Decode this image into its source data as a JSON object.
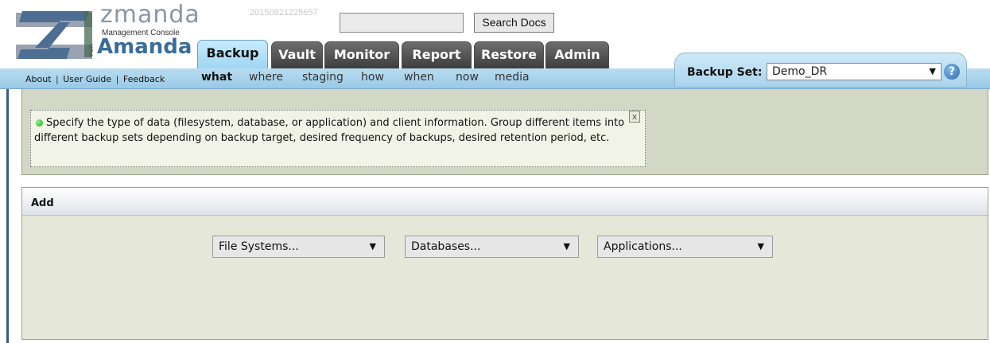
{
  "header": {
    "logo": {
      "brand": "zmanda",
      "subtitle": "Management Console",
      "for_label": "FOR",
      "product": "Amanda"
    },
    "build_id": "20150821225657",
    "search": {
      "value": "",
      "button_label": "Search Docs"
    }
  },
  "tabs": [
    {
      "label": "Backup",
      "active": true
    },
    {
      "label": "Vault",
      "active": false
    },
    {
      "label": "Monitor",
      "active": false
    },
    {
      "label": "Report",
      "active": false
    },
    {
      "label": "Restore",
      "active": false
    },
    {
      "label": "Admin",
      "active": false
    }
  ],
  "nav_links": {
    "about": "About",
    "user_guide": "User Guide",
    "feedback": "Feedback",
    "separator": "|"
  },
  "subtabs": [
    {
      "label": "what",
      "active": true
    },
    {
      "label": "where",
      "active": false
    },
    {
      "label": "staging",
      "active": false
    },
    {
      "label": "how",
      "active": false
    },
    {
      "label": "when",
      "active": false
    },
    {
      "label": "now",
      "active": false
    },
    {
      "label": "media",
      "active": false
    }
  ],
  "backup_set": {
    "label": "Backup Set:",
    "selected": "Demo_DR",
    "help_icon": "?"
  },
  "info": {
    "text": "Specify the type of data (filesystem, database, or application) and client information. Group different items into different backup sets depending on backup target, desired frequency of backups, desired retention period, etc.",
    "close_label": "x",
    "status_color": "#1aa51a"
  },
  "add_panel": {
    "title": "Add",
    "dropdowns": [
      {
        "value": "File Systems..."
      },
      {
        "value": "Databases..."
      },
      {
        "value": "Applications..."
      }
    ]
  },
  "colors": {
    "tab_active": "#a9dcf5",
    "tab_inactive": "#4d4d4d",
    "nav_strip": "#a9d3ec",
    "panel_bg": "#e5e8d8",
    "info_bg": "#d3d8c6"
  },
  "icons": {
    "dropdown_arrow": "▼",
    "help": "help-icon",
    "status": "green-dot-icon",
    "logo": "zmanda-logo-icon"
  }
}
